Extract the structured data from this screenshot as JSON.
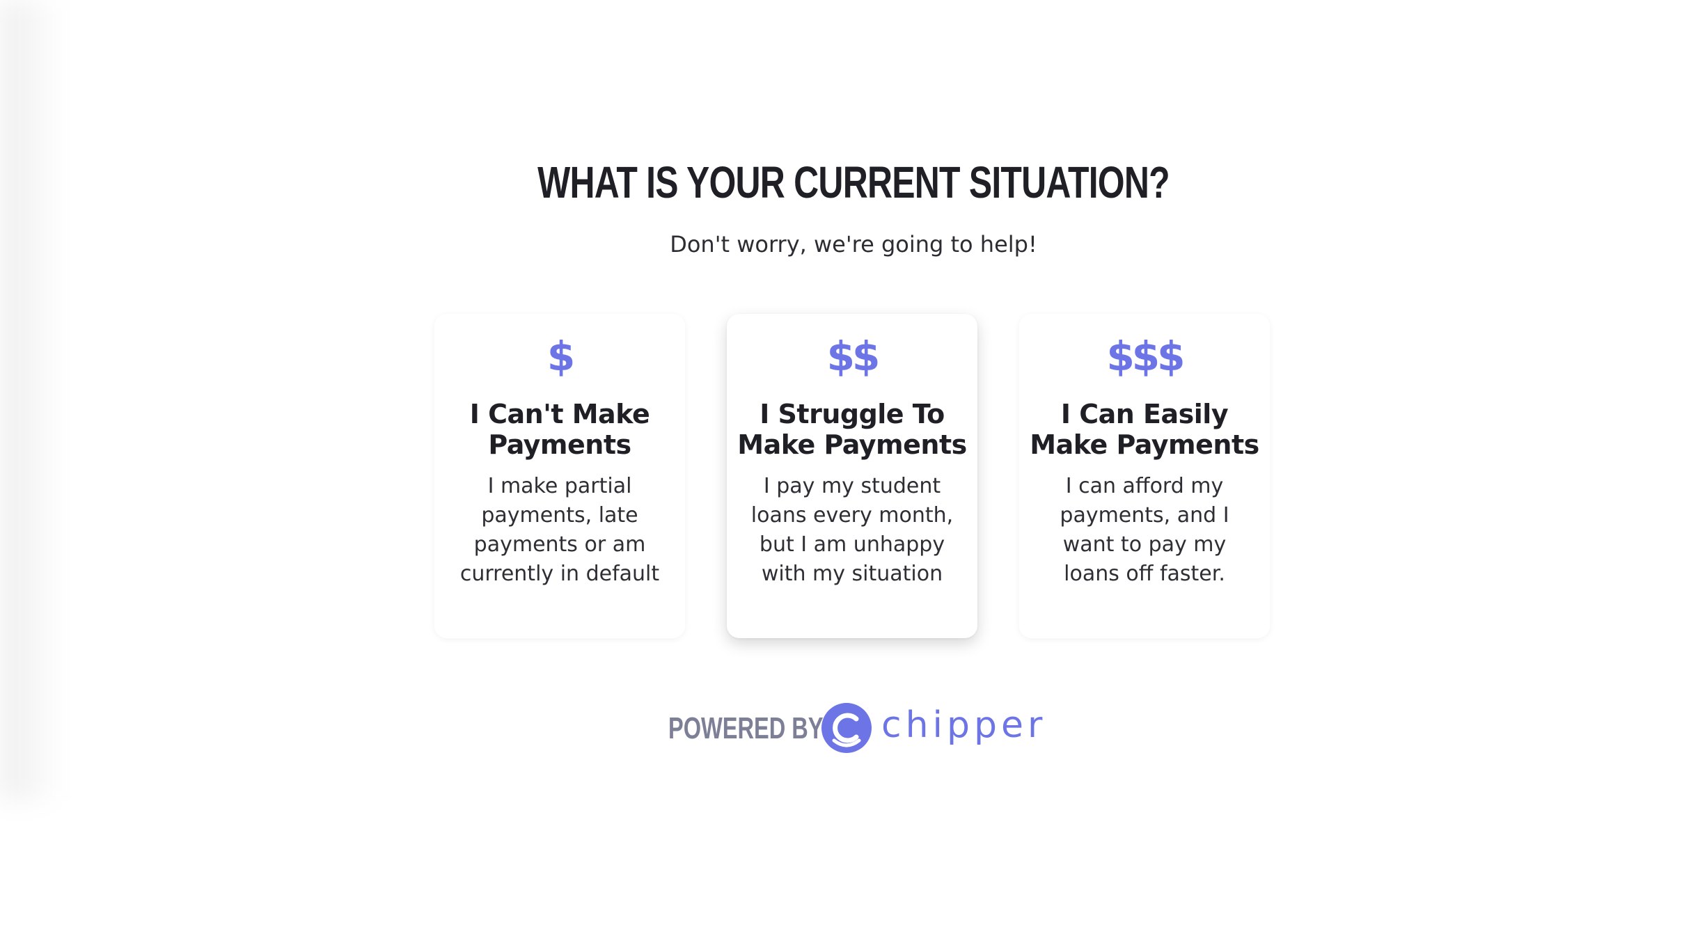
{
  "header": {
    "title": "WHAT IS YOUR CURRENT SITUATION?",
    "subtitle": "Don't worry, we're going to help!"
  },
  "options": [
    {
      "icon": "dollar-1-icon",
      "icon_text": "$",
      "title_line1": "I Can't Make",
      "title_line2": "Payments",
      "description": "I make partial payments, late payments or am currently in default",
      "selected": false
    },
    {
      "icon": "dollar-2-icon",
      "icon_text": "$$",
      "title_line1": "I Struggle To",
      "title_line2": "Make Payments",
      "description": "I pay my student loans every month, but I am unhappy with my situation",
      "selected": true
    },
    {
      "icon": "dollar-3-icon",
      "icon_text": "$$$",
      "title_line1": "I Can Easily",
      "title_line2": "Make Payments",
      "description": "I can afford my payments, and I want to pay my loans off faster.",
      "selected": false
    }
  ],
  "footer": {
    "powered_by": "POWERED BY",
    "brand": "chipper",
    "logo_icon": "chipper-logo-icon"
  },
  "colors": {
    "accent": "#6c74e6",
    "text": "#1f2026",
    "muted": "#7d7f96"
  }
}
